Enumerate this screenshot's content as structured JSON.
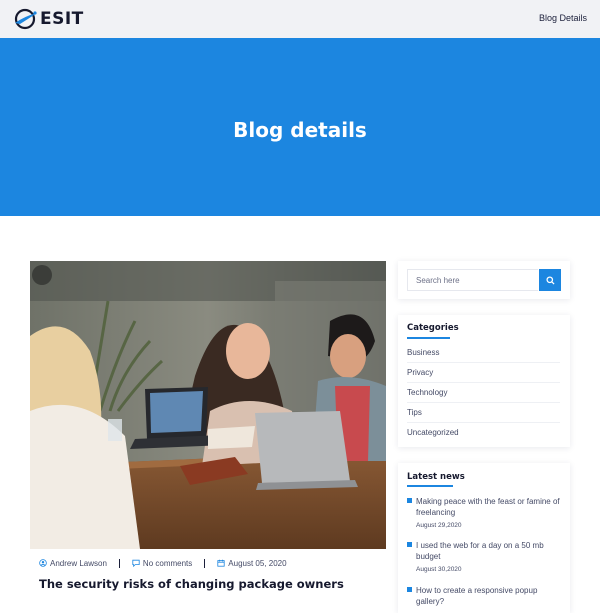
{
  "header": {
    "logo_text": "ESIT",
    "nav_link": "Blog Details"
  },
  "hero": {
    "title": "Blog details"
  },
  "post": {
    "author": "Andrew Lawson",
    "comments": "No comments",
    "date": "August 05, 2020",
    "title": "The security risks of changing package owners"
  },
  "sidebar": {
    "search": {
      "placeholder": "Search here"
    },
    "categories": {
      "title": "Categories",
      "items": [
        "Business",
        "Privacy",
        "Technology",
        "Tips",
        "Uncategorized"
      ]
    },
    "latest_news": {
      "title": "Latest news",
      "items": [
        {
          "title": "Making peace with the feast or famine of freelancing",
          "date": "August 29,2020"
        },
        {
          "title": "I used the web for a day on a 50 mb budget",
          "date": "August 30,2020"
        },
        {
          "title": "How to create a responsive popup gallery?",
          "date": ""
        }
      ]
    }
  },
  "colors": {
    "accent": "#1c86e0",
    "topbar_bg": "#f1f2f5",
    "heading": "#16192e",
    "body_text": "#444a66"
  },
  "icons": [
    "logo-swoosh-icon",
    "user-icon",
    "comment-icon",
    "calendar-icon",
    "search-icon"
  ]
}
